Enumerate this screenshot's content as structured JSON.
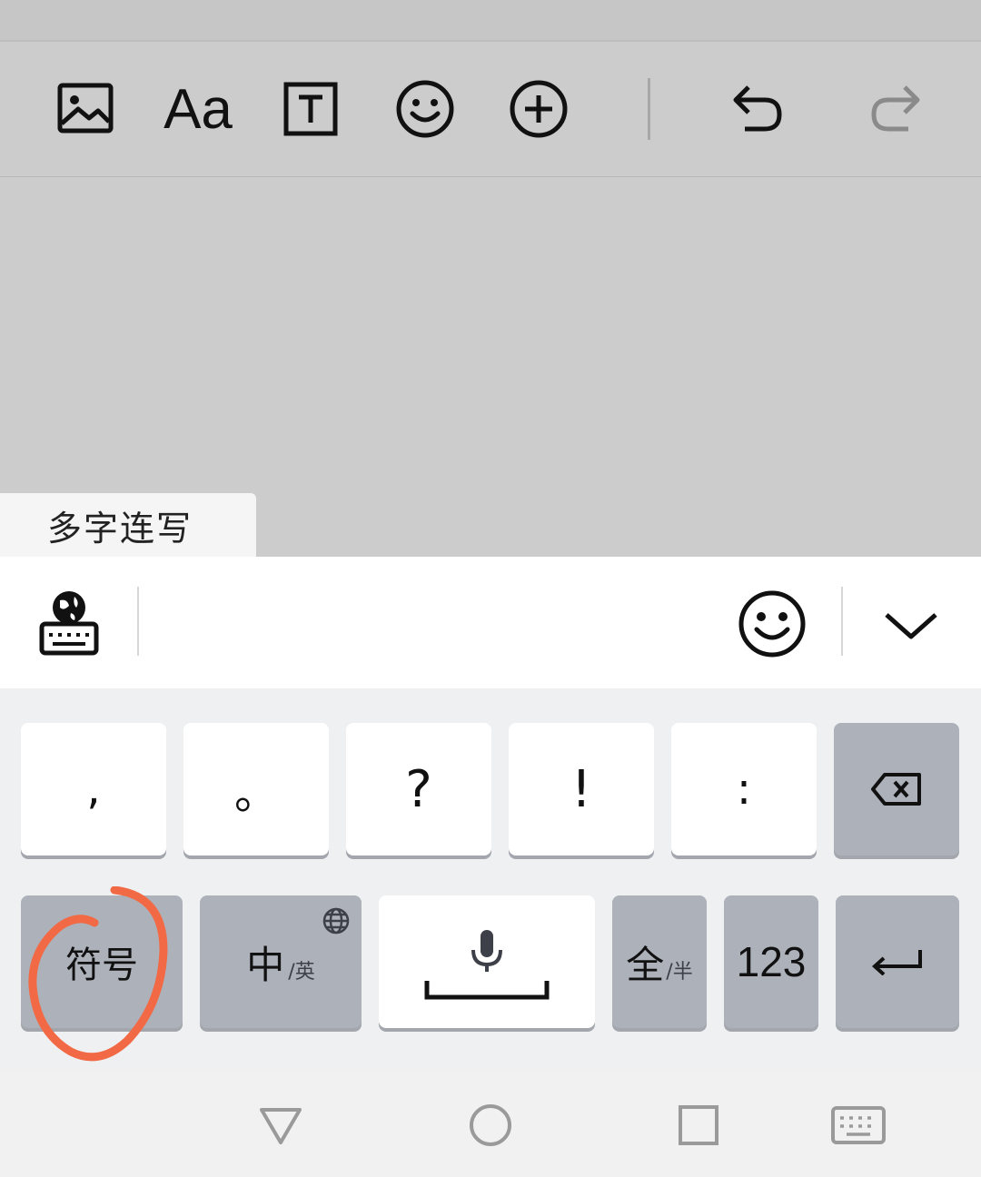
{
  "toolbar": {
    "icons": [
      "image-icon",
      "font-style-icon",
      "text-box-icon",
      "emoji-icon",
      "add-icon",
      "undo-icon",
      "redo-icon"
    ],
    "font_label": "Aa"
  },
  "suggestion": {
    "label": "多字连写"
  },
  "candidate_bar": {
    "icons": [
      "keyboard-globe-icon",
      "emoji-icon",
      "collapse-chevron-icon"
    ]
  },
  "keyboard": {
    "row1": [
      ",",
      "。",
      "?",
      "!",
      ":"
    ],
    "row2": {
      "symbols": "符号",
      "lang_main": "中",
      "lang_sub": "/英",
      "width_main": "全",
      "width_sub": "/半",
      "numbers": "123"
    }
  },
  "annotation": {
    "color": "#f26a45"
  },
  "colors": {
    "key_white": "#ffffff",
    "key_gray": "#acb1ba",
    "keyboard_bg": "#eef0f2"
  }
}
